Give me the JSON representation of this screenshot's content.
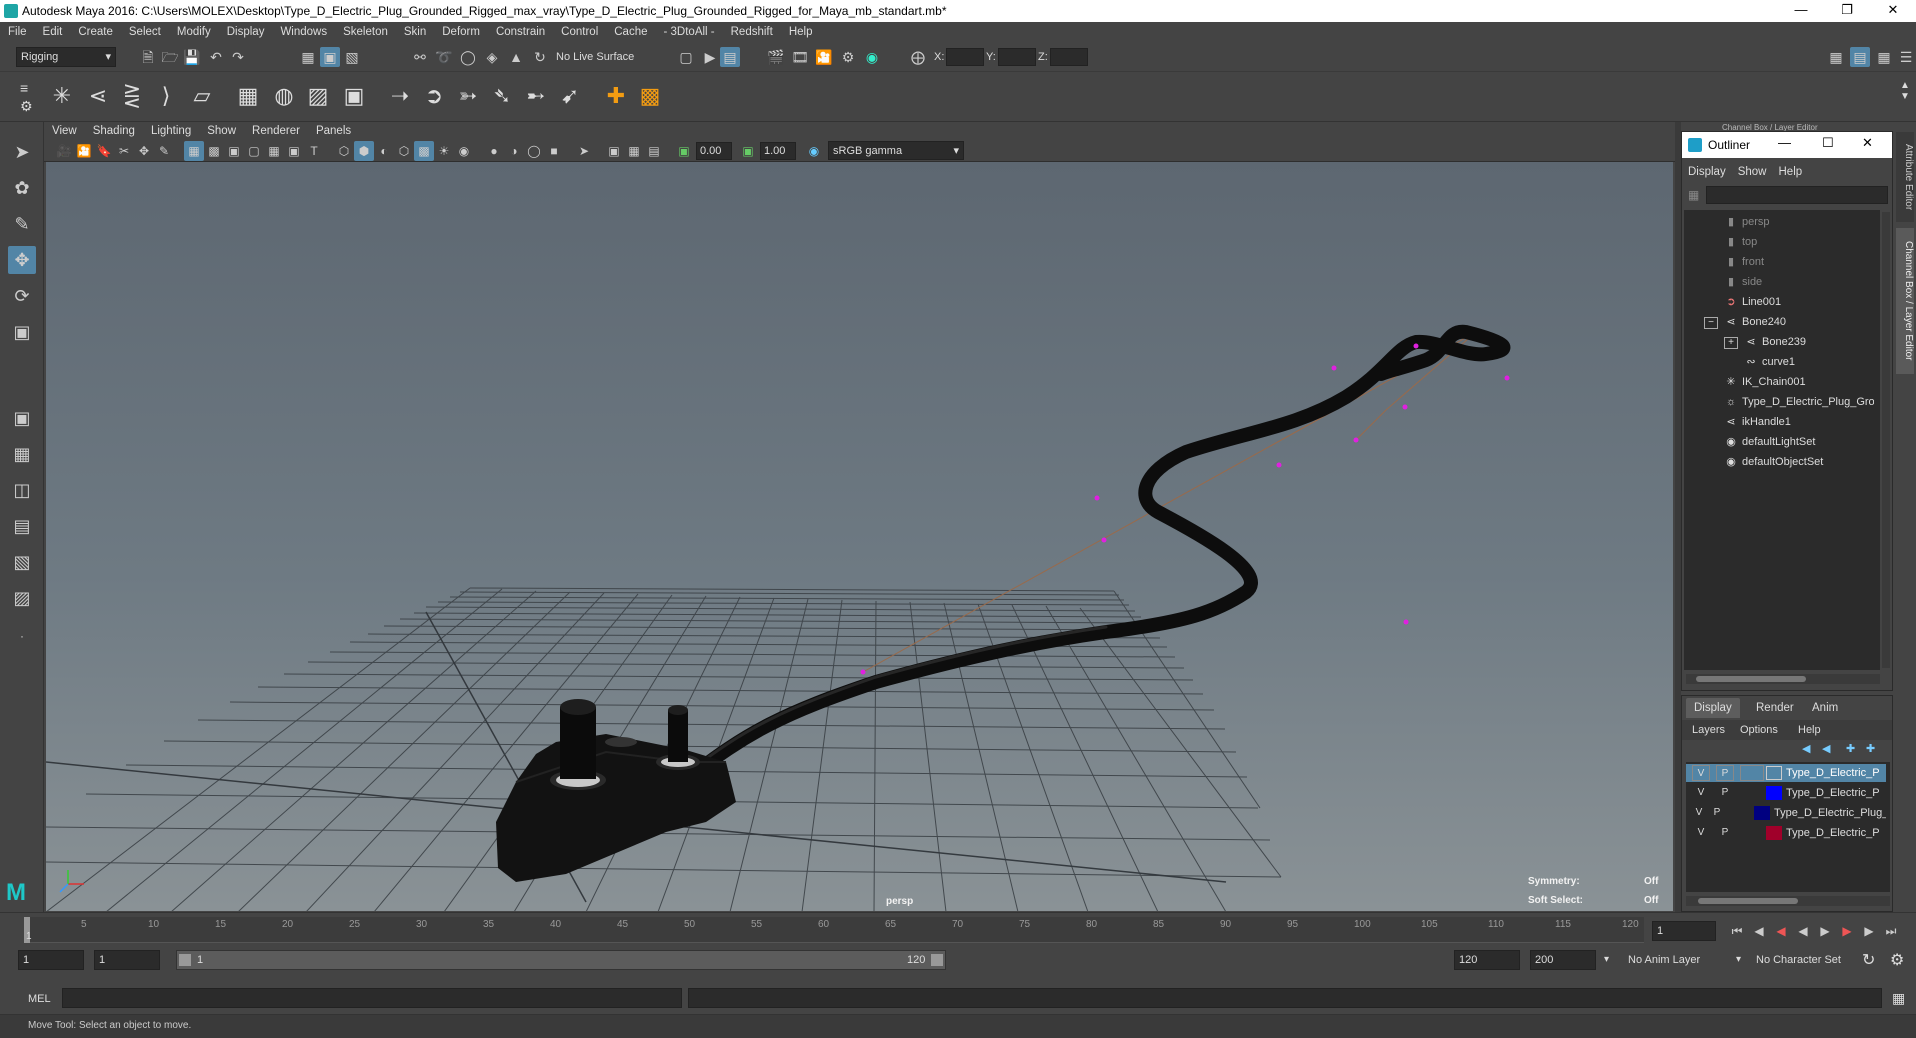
{
  "window": {
    "title": "Autodesk Maya 2016: C:\\Users\\MOLEX\\Desktop\\Type_D_Electric_Plug_Grounded_Rigged_max_vray\\Type_D_Electric_Plug_Grounded_Rigged_for_Maya_mb_standart.mb*"
  },
  "menubar": [
    "File",
    "Edit",
    "Create",
    "Select",
    "Modify",
    "Display",
    "Windows",
    "Skeleton",
    "Skin",
    "Deform",
    "Constrain",
    "Control",
    "Cache",
    "- 3DtoAll -",
    "Redshift",
    "Help"
  ],
  "status": {
    "menuset": "Rigging",
    "live_surface": "No Live Surface",
    "x_label": "X:",
    "y_label": "Y:",
    "z_label": "Z:"
  },
  "viewport": {
    "menus": [
      "View",
      "Shading",
      "Lighting",
      "Show",
      "Renderer",
      "Panels"
    ],
    "exposure": "0.00",
    "gamma": "1.00",
    "color_space": "sRGB gamma",
    "camera_label": "persp",
    "symmetry_label": "Symmetry:",
    "symmetry_value": "Off",
    "soft_select_label": "Soft Select:",
    "soft_select_value": "Off"
  },
  "side_tabs": {
    "attribute_editor": "Attribute Editor",
    "channel_box": "Channel Box / Layer Editor",
    "channel_box_header": "Channel Box / Layer Editor"
  },
  "outliner": {
    "title": "Outliner",
    "menus": [
      "Display",
      "Show",
      "Help"
    ],
    "items": [
      {
        "label": "persp",
        "icon": "camera-icon",
        "dim": true
      },
      {
        "label": "top",
        "icon": "camera-icon",
        "dim": true
      },
      {
        "label": "front",
        "icon": "camera-icon",
        "dim": true
      },
      {
        "label": "side",
        "icon": "camera-icon",
        "dim": true
      },
      {
        "label": "Line001",
        "icon": "curve-icon",
        "dim": false
      },
      {
        "label": "Bone240",
        "icon": "joint-icon",
        "dim": false
      },
      {
        "label": "Bone239",
        "icon": "joint-icon",
        "dim": false
      },
      {
        "label": "curve1",
        "icon": "curve-icon",
        "dim": false
      },
      {
        "label": "IK_Chain001",
        "icon": "ik-icon",
        "dim": false
      },
      {
        "label": "Type_D_Electric_Plug_Grou",
        "icon": "group-icon",
        "dim": false
      },
      {
        "label": "ikHandle1",
        "icon": "ikhandle-icon",
        "dim": false
      },
      {
        "label": "defaultLightSet",
        "icon": "set-icon",
        "dim": false
      },
      {
        "label": "defaultObjectSet",
        "icon": "set-icon",
        "dim": false
      }
    ]
  },
  "layers": {
    "tabs": [
      "Display",
      "Render",
      "Anim"
    ],
    "menus": [
      "Layers",
      "Options",
      "Help"
    ],
    "rows": [
      {
        "v": "V",
        "p": "P",
        "color": "#444444",
        "name": "Type_D_Electric_Plug_G"
      },
      {
        "v": "V",
        "p": "P",
        "color": "#0000ff",
        "name": "Type_D_Electric_Plug_G"
      },
      {
        "v": "V",
        "p": "P",
        "color": "#000080",
        "name": "Type_D_Electric_Plug_Gro"
      },
      {
        "v": "V",
        "p": "P",
        "color": "#a0002a",
        "name": "Type_D_Electric_Plug_G"
      }
    ]
  },
  "timeline": {
    "ticks": [
      "1",
      "5",
      "10",
      "15",
      "20",
      "25",
      "30",
      "35",
      "40",
      "45",
      "50",
      "55",
      "60",
      "65",
      "70",
      "75",
      "80",
      "85",
      "90",
      "95",
      "100",
      "105",
      "110",
      "115",
      "120"
    ],
    "current_frame": "1"
  },
  "range": {
    "start": "1",
    "anim_start": "1",
    "range_start": "1",
    "range_end": "120",
    "end": "120",
    "anim_end": "200",
    "anim_layer": "No Anim Layer",
    "character_set": "No Character Set"
  },
  "command": {
    "label": "MEL"
  },
  "help": {
    "text": "Move Tool: Select an object to move."
  }
}
